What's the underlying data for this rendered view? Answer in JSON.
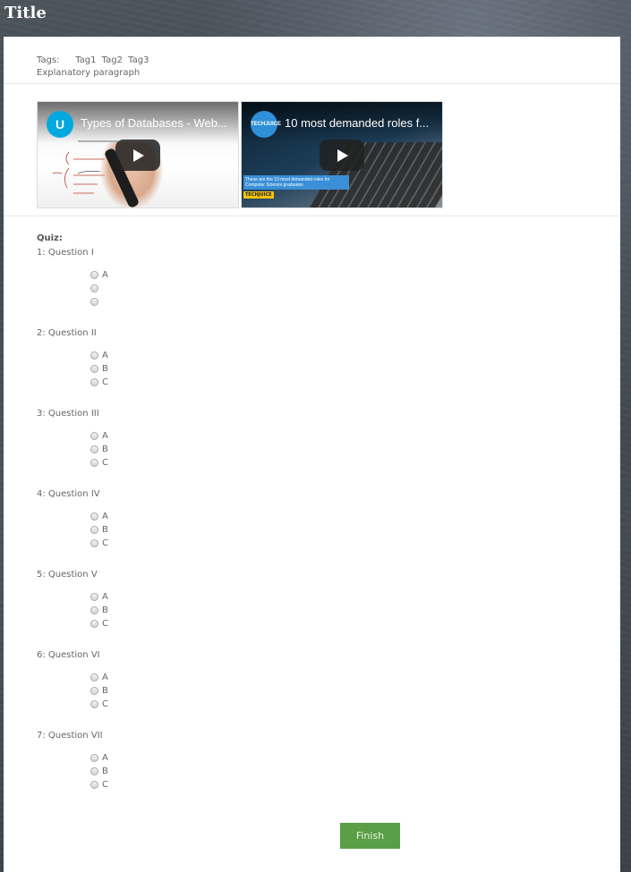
{
  "page": {
    "title": "Title"
  },
  "meta": {
    "tags_label": "Tags:",
    "tags": [
      "Tag1",
      "Tag2",
      "Tag3"
    ],
    "paragraph": "Explanatory paragraph"
  },
  "videos": [
    {
      "title": "Types of Databases - Web...",
      "logo_text": "U"
    },
    {
      "title": "10 most demanded roles f...",
      "logo_text": "TECHJUICE",
      "caption": "These are the 10 most demanded roles for Computer Science graduates",
      "brand": "TECHJUICE"
    }
  ],
  "quiz": {
    "label": "Quiz:",
    "questions": [
      {
        "text": "1: Question I",
        "options": [
          "A",
          "",
          ""
        ]
      },
      {
        "text": "2: Question II",
        "options": [
          "A",
          "B",
          "C"
        ]
      },
      {
        "text": "3: Question III",
        "options": [
          "A",
          "B",
          "C"
        ]
      },
      {
        "text": "4: Question IV",
        "options": [
          "A",
          "B",
          "C"
        ]
      },
      {
        "text": "5: Question V",
        "options": [
          "A",
          "B",
          "C"
        ]
      },
      {
        "text": "6: Question VI",
        "options": [
          "A",
          "B",
          "C"
        ]
      },
      {
        "text": "7: Question VII",
        "options": [
          "A",
          "B",
          "C"
        ]
      }
    ]
  },
  "finish_label": "Finish",
  "colors": {
    "accent": "#5a9e46",
    "background": "#3e454c"
  }
}
